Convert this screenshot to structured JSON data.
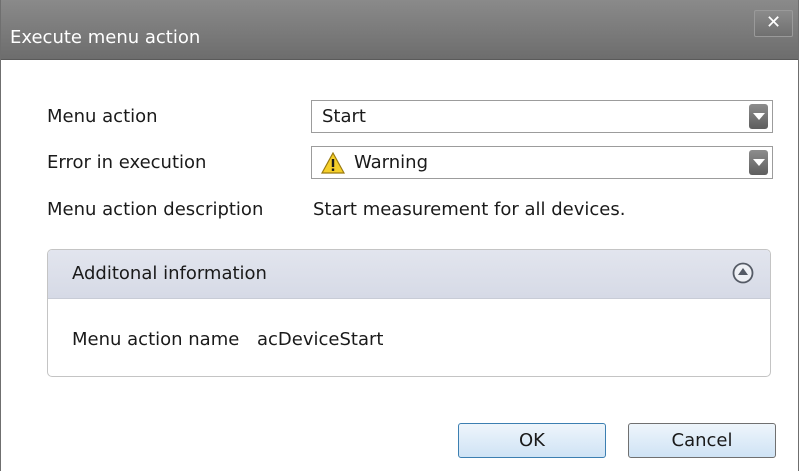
{
  "window": {
    "title": "Execute menu action",
    "close_label": "✕"
  },
  "form": {
    "menu_action_label": "Menu action",
    "menu_action_value": "Start",
    "error_label": "Error in execution",
    "error_value": "Warning",
    "error_icon": "warning-icon",
    "description_label": "Menu action description",
    "description_value": "Start measurement for all devices."
  },
  "additional": {
    "title": "Additonal information",
    "collapse_icon": "collapse-up-icon",
    "name_label": "Menu action name",
    "name_value": "acDeviceStart"
  },
  "buttons": {
    "ok_label": "OK",
    "cancel_label": "Cancel"
  }
}
